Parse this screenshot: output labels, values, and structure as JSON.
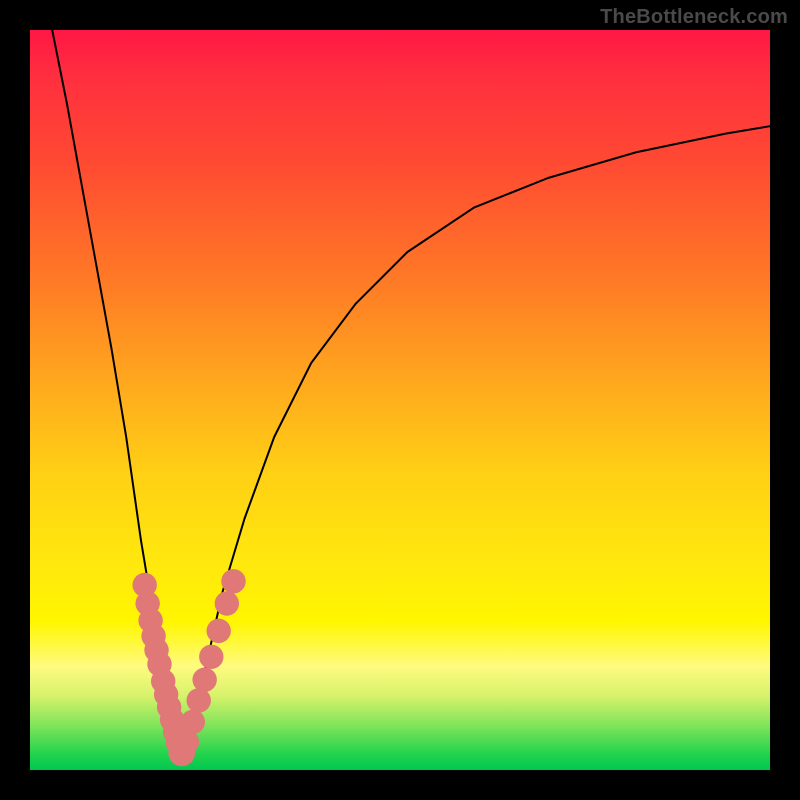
{
  "watermark": "TheBottleneck.com",
  "colors": {
    "frame": "#000000",
    "curve": "#000000",
    "marker_fill": "#e07878",
    "marker_stroke": "#b85a5a",
    "gradient_top": "#ff1744",
    "gradient_bottom": "#00c853"
  },
  "chart_data": {
    "type": "line",
    "title": "",
    "xlabel": "",
    "ylabel": "",
    "xlim": [
      0,
      100
    ],
    "ylim": [
      0,
      100
    ],
    "grid": false,
    "legend": false,
    "note": "Axes are unlabeled; values are percent of plot width/height estimated from pixels. y increases upward (0 at bottom of colored area).",
    "series": [
      {
        "name": "left-branch",
        "x": [
          3,
          5,
          7,
          9,
          11,
          13,
          14,
          15,
          16,
          17,
          18,
          19,
          19.8,
          20.5
        ],
        "y": [
          100,
          90,
          79,
          68,
          57,
          45,
          38,
          31,
          25,
          19,
          14,
          9,
          5,
          2
        ]
      },
      {
        "name": "right-branch",
        "x": [
          20.5,
          22,
          24,
          26,
          29,
          33,
          38,
          44,
          51,
          60,
          70,
          82,
          94,
          100
        ],
        "y": [
          2,
          7,
          15,
          24,
          34,
          45,
          55,
          63,
          70,
          76,
          80,
          83.5,
          86,
          87
        ]
      }
    ],
    "markers": [
      {
        "x": 15.5,
        "y": 25,
        "r": 1.3
      },
      {
        "x": 15.9,
        "y": 22.5,
        "r": 1.3
      },
      {
        "x": 16.3,
        "y": 20.2,
        "r": 1.3
      },
      {
        "x": 16.7,
        "y": 18.1,
        "r": 1.3
      },
      {
        "x": 17.1,
        "y": 16.2,
        "r": 1.3
      },
      {
        "x": 17.5,
        "y": 14.3,
        "r": 1.3
      },
      {
        "x": 18.0,
        "y": 12.0,
        "r": 1.3
      },
      {
        "x": 18.4,
        "y": 10.2,
        "r": 1.3
      },
      {
        "x": 18.8,
        "y": 8.5,
        "r": 1.3
      },
      {
        "x": 19.2,
        "y": 6.8,
        "r": 1.3
      },
      {
        "x": 19.6,
        "y": 5.2,
        "r": 1.3
      },
      {
        "x": 20.0,
        "y": 3.7,
        "r": 1.3
      },
      {
        "x": 20.5,
        "y": 2.3,
        "r": 1.5
      },
      {
        "x": 21.2,
        "y": 3.8,
        "r": 1.3
      },
      {
        "x": 22.0,
        "y": 6.5,
        "r": 1.3
      },
      {
        "x": 22.8,
        "y": 9.4,
        "r": 1.3
      },
      {
        "x": 23.6,
        "y": 12.2,
        "r": 1.3
      },
      {
        "x": 24.5,
        "y": 15.3,
        "r": 1.3
      },
      {
        "x": 25.5,
        "y": 18.8,
        "r": 1.3
      },
      {
        "x": 26.6,
        "y": 22.5,
        "r": 1.3
      },
      {
        "x": 27.5,
        "y": 25.5,
        "r": 1.3
      }
    ]
  }
}
